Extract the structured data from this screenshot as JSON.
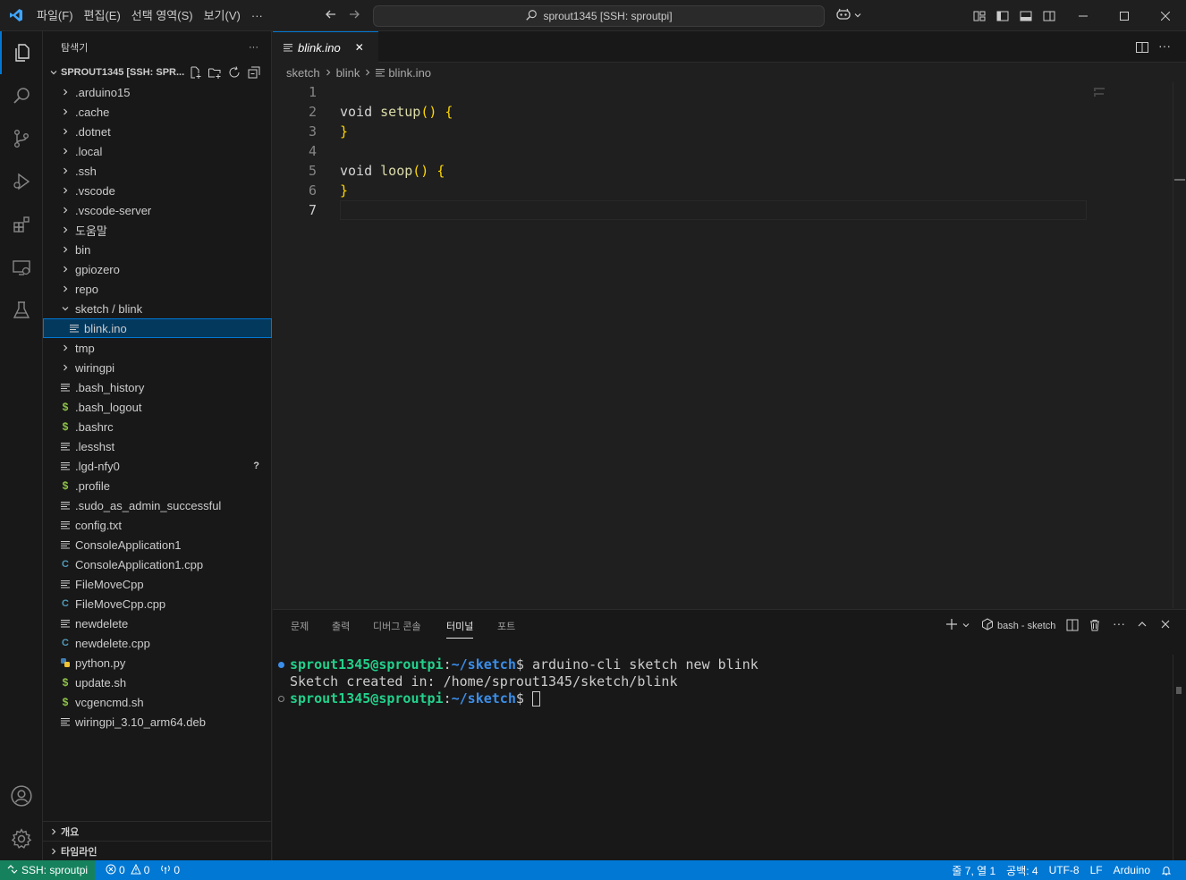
{
  "titlebar": {
    "menu": [
      {
        "label": "파일",
        "key": "(F)"
      },
      {
        "label": "편집",
        "key": "(E)"
      },
      {
        "label": "선택 영역",
        "key": "(S)"
      },
      {
        "label": "보기",
        "key": "(V)"
      }
    ],
    "more": "···",
    "command_center": "sprout1345 [SSH: sproutpi]"
  },
  "sidebar": {
    "title": "탐색기",
    "more": "···",
    "root_label": "SPROUT1345 [SSH: SPR...",
    "items": [
      {
        "label": ".arduino15",
        "kind": "folder"
      },
      {
        "label": ".cache",
        "kind": "folder"
      },
      {
        "label": ".dotnet",
        "kind": "folder"
      },
      {
        "label": ".local",
        "kind": "folder"
      },
      {
        "label": ".ssh",
        "kind": "folder"
      },
      {
        "label": ".vscode",
        "kind": "folder"
      },
      {
        "label": ".vscode-server",
        "kind": "folder"
      },
      {
        "label": "도움말",
        "kind": "folder"
      },
      {
        "label": "bin",
        "kind": "folder"
      },
      {
        "label": "gpiozero",
        "kind": "folder"
      },
      {
        "label": "repo",
        "kind": "folder"
      },
      {
        "label": "sketch / blink",
        "kind": "folder-open"
      },
      {
        "label": "blink.ino",
        "kind": "file-nested"
      },
      {
        "label": "tmp",
        "kind": "folder"
      },
      {
        "label": "wiringpi",
        "kind": "folder"
      },
      {
        "label": ".bash_history",
        "kind": "text"
      },
      {
        "label": ".bash_logout",
        "kind": "shell"
      },
      {
        "label": ".bashrc",
        "kind": "shell"
      },
      {
        "label": ".lesshst",
        "kind": "text"
      },
      {
        "label": ".lgd-nfy0",
        "kind": "text",
        "badge": "?"
      },
      {
        "label": ".profile",
        "kind": "shell"
      },
      {
        "label": ".sudo_as_admin_successful",
        "kind": "text"
      },
      {
        "label": "config.txt",
        "kind": "text"
      },
      {
        "label": "ConsoleApplication1",
        "kind": "text"
      },
      {
        "label": "ConsoleApplication1.cpp",
        "kind": "cpp"
      },
      {
        "label": "FileMoveCpp",
        "kind": "text"
      },
      {
        "label": "FileMoveCpp.cpp",
        "kind": "cpp"
      },
      {
        "label": "newdelete",
        "kind": "text"
      },
      {
        "label": "newdelete.cpp",
        "kind": "cpp"
      },
      {
        "label": "python.py",
        "kind": "python"
      },
      {
        "label": "update.sh",
        "kind": "shell"
      },
      {
        "label": "vcgencmd.sh",
        "kind": "shell"
      },
      {
        "label": "wiringpi_3.10_arm64.deb",
        "kind": "text"
      }
    ],
    "outline_label": "개요",
    "timeline_label": "타임라인"
  },
  "editor": {
    "tab_label": "blink.ino",
    "tab_close": "✕",
    "breadcrumb": [
      "sketch",
      "blink",
      "blink.ino"
    ],
    "line_numbers": [
      "1",
      "2",
      "3",
      "4",
      "5",
      "6",
      "7"
    ],
    "lines": [
      {
        "text": ""
      },
      {
        "kw": "void",
        "fn": "setup",
        "rest": "()",
        "brace": "{"
      },
      {
        "brace": "}"
      },
      {
        "text": ""
      },
      {
        "kw": "void",
        "fn": "loop",
        "rest": "()",
        "brace": "{"
      },
      {
        "brace": "}"
      },
      {
        "text": ""
      }
    ]
  },
  "panel": {
    "tabs": [
      "문제",
      "출력",
      "디버그 콘솔",
      "터미널",
      "포트"
    ],
    "active_tab": "터미널",
    "terminal_name": "bash - sketch",
    "terminal": {
      "line1_user": "sprout1345@sproutpi",
      "line1_colon": ":",
      "line1_path": "~/sketch",
      "line1_dollar": "$ ",
      "line1_cmd": "arduino-cli sketch new blink",
      "line2": "Sketch created in: /home/sprout1345/sketch/blink",
      "line3_user": "sprout1345@sproutpi",
      "line3_colon": ":",
      "line3_path": "~/sketch",
      "line3_dollar": "$ "
    }
  },
  "statusbar": {
    "remote": "SSH: sproutpi",
    "errors": "0",
    "warnings": "0",
    "ports": "0",
    "position": "줄 7, 열 1",
    "spaces": "공백: 4",
    "encoding": "UTF-8",
    "eol": "LF",
    "language": "Arduino"
  },
  "colors": {
    "accent": "#0078d4",
    "remote": "#16825d",
    "prompt_user": "#23d18b",
    "prompt_path": "#3b8eea"
  }
}
